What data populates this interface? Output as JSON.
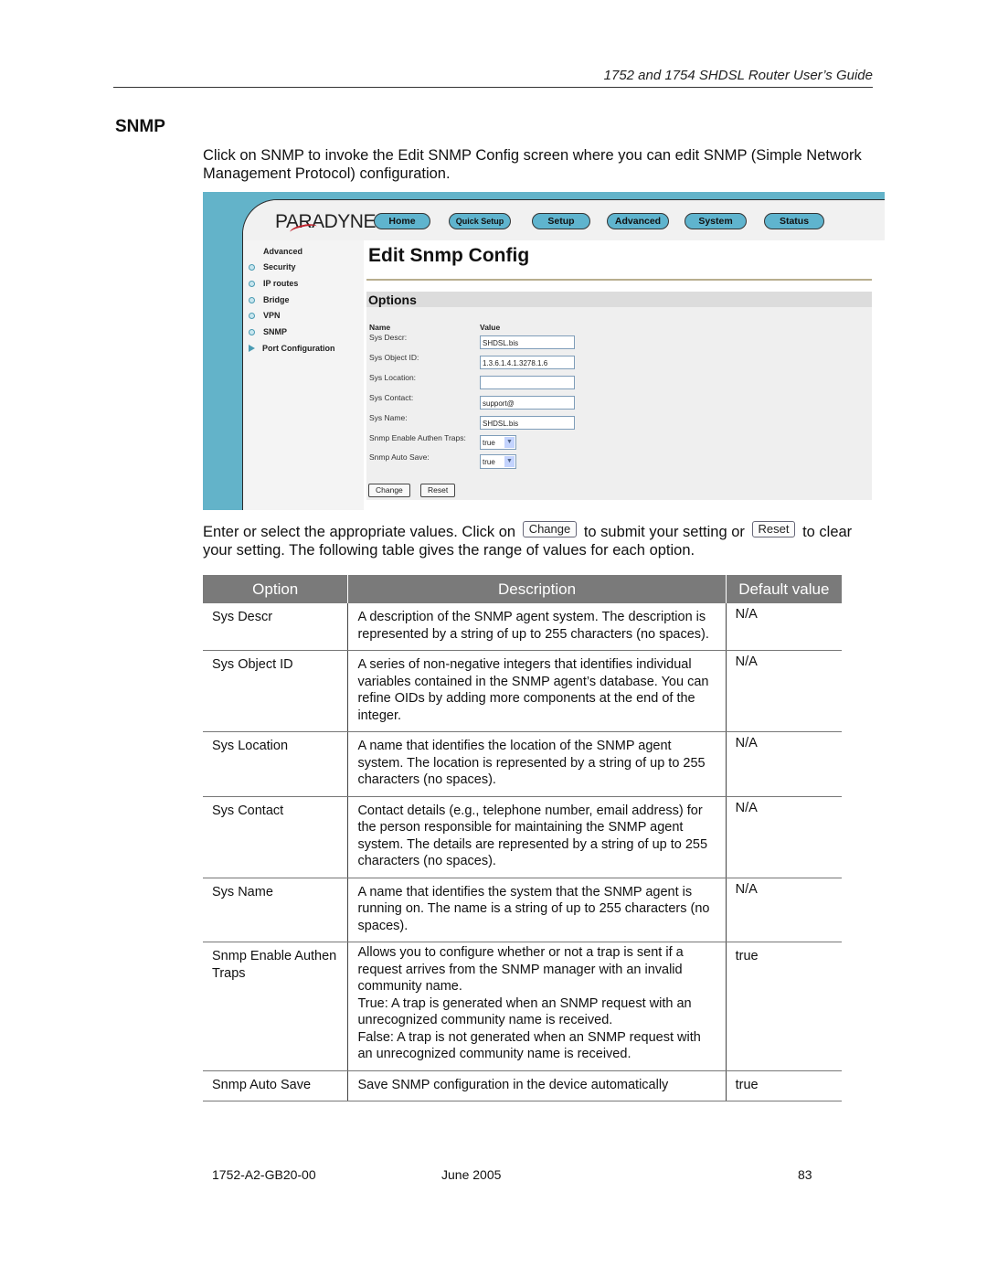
{
  "header": {
    "running_title": "1752 and 1754 SHDSL Router User’s Guide"
  },
  "section": {
    "title": "SNMP",
    "intro": "Click on SNMP to invoke the Edit SNMP Config screen where you can edit SNMP (Simple Network Management Protocol) configuration."
  },
  "screenshot": {
    "logo": "PARADYNE",
    "nav": [
      "Home",
      "Quick Setup",
      "Setup",
      "Advanced",
      "System",
      "Status"
    ],
    "sidebar": {
      "heading": "Advanced",
      "items": [
        "Security",
        "IP routes",
        "Bridge",
        "VPN",
        "SNMP",
        "Port Configuration"
      ]
    },
    "page_title": "Edit Snmp Config",
    "options_title": "Options",
    "col_name": "Name",
    "col_value": "Value",
    "fields": [
      {
        "label": "Sys Descr:",
        "value": "SHDSL.bis",
        "type": "text"
      },
      {
        "label": "Sys Object ID:",
        "value": "1.3.6.1.4.1.3278.1.6",
        "type": "text"
      },
      {
        "label": "Sys Location:",
        "value": "",
        "type": "text"
      },
      {
        "label": "Sys Contact:",
        "value": "support@",
        "type": "text"
      },
      {
        "label": "Sys Name:",
        "value": "SHDSL.bis",
        "type": "text"
      },
      {
        "label": "Snmp Enable Authen Traps:",
        "value": "true",
        "type": "select"
      },
      {
        "label": "Snmp Auto Save:",
        "value": "true",
        "type": "select"
      }
    ],
    "change_label": "Change",
    "reset_label": "Reset",
    "colors": {
      "frame": "#63b3c9",
      "nav_button": "#5fb4ce"
    }
  },
  "instructions": {
    "part1": "Enter or select the appropriate values. Click on",
    "change_label": "Change",
    "part2": "to submit your setting or",
    "reset_label": "Reset",
    "part3": "to clear your setting. The following table gives the range of values for each option."
  },
  "table": {
    "headers": [
      "Option",
      "Description",
      "Default value"
    ],
    "rows": [
      {
        "option": "Sys Descr",
        "description": "A description of the SNMP agent system. The description is represented by a string of up to 255 characters (no spaces).",
        "default": "N/A"
      },
      {
        "option": "Sys Object ID",
        "description": "A series of non-negative integers that identifies individual variables contained in the SNMP agent’s database. You can refine OIDs by adding more components at the end of the integer.",
        "default": "N/A"
      },
      {
        "option": "Sys Location",
        "description": "A name that identifies the location of the SNMP agent system. The location is represented by a string of up to 255 characters (no spaces).",
        "default": "N/A"
      },
      {
        "option": "Sys Contact",
        "description": "Contact details (e.g., telephone number, email address) for the person responsible for maintaining the SNMP agent system. The details are represented by a string of up to 255 characters (no spaces).",
        "default": "N/A"
      },
      {
        "option": "Sys Name",
        "description": "A name that identifies the system that the SNMP agent is running on. The name is a string of up to 255 characters (no spaces).",
        "default": "N/A"
      },
      {
        "option": "Snmp Enable Authen Traps",
        "description": "Allows you to configure whether or not a trap is sent if a request arrives from the SNMP manager with an invalid community name.",
        "description_true": "True: A trap is generated when an SNMP request with an unrecognized community name is received.",
        "description_false": "False: A trap is not generated when an SNMP request with an unrecognized community name is received.",
        "default": "true"
      },
      {
        "option": "Snmp Auto Save",
        "description": "Save SNMP configuration in the device automatically",
        "default": "true"
      }
    ],
    "header_bg": "#7a7a7a"
  },
  "footer": {
    "doc_number": "1752-A2-GB20-00",
    "date": "June 2005",
    "page": "83"
  }
}
